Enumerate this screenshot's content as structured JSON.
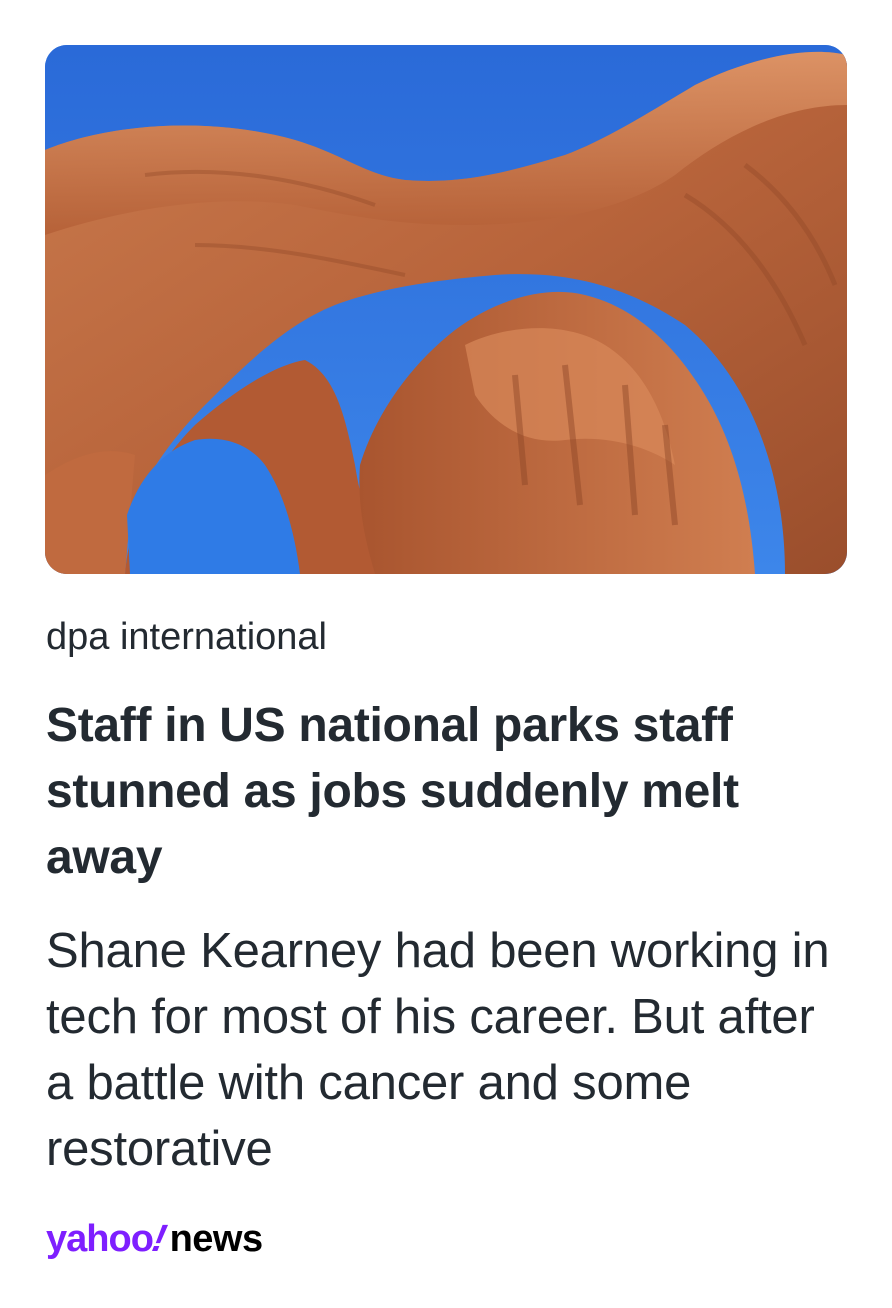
{
  "article": {
    "image_alt": "Double arch rock formation under a blue sky",
    "source": "dpa international",
    "headline": "Staff in US national parks staff stunned as jobs suddenly melt away",
    "summary": "Shane Kearney had been working in tech for most of his career. But after a battle with cancer and some restorative"
  },
  "brand": {
    "yahoo": "yahoo",
    "bang": "!",
    "news": "news",
    "colors": {
      "purple": "#7e1fff",
      "text": "#232a31"
    }
  },
  "colors": {
    "sky": "#2f74e0",
    "rock_light": "#d98859",
    "rock_mid": "#b8643b",
    "rock_dark": "#8c4525"
  }
}
